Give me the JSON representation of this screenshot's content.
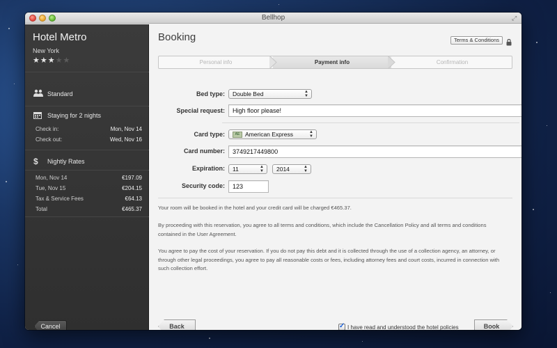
{
  "window": {
    "title": "Bellhop"
  },
  "sidebar": {
    "hotel_name": "Hotel Metro",
    "city": "New York",
    "stars_filled": 3,
    "stars_total": 5,
    "room_type": "Standard",
    "stay": {
      "heading": "Staying for 2 nights",
      "check_in_label": "Check in:",
      "check_in_value": "Mon, Nov 14",
      "check_out_label": "Check out:",
      "check_out_value": "Wed, Nov 16"
    },
    "rates": {
      "heading": "Nightly Rates",
      "items": [
        {
          "label": "Mon, Nov 14",
          "value": "€197.09"
        },
        {
          "label": "Tue, Nov 15",
          "value": "€204.15"
        },
        {
          "label": "Tax & Service Fees",
          "value": "€64.13"
        },
        {
          "label": "Total",
          "value": "€465.37"
        }
      ]
    },
    "cancel_label": "Cancel"
  },
  "main": {
    "title": "Booking",
    "terms_label": "Terms & Conditions",
    "steps": [
      {
        "label": "Personal info",
        "state": "done"
      },
      {
        "label": "Payment info",
        "state": "active"
      },
      {
        "label": "Confirmation",
        "state": "pending"
      }
    ],
    "form": {
      "bed_type_label": "Bed type:",
      "bed_type_value": "Double Bed",
      "special_request_label": "Special request:",
      "special_request_value": "High floor please!",
      "card_type_label": "Card type:",
      "card_type_value": "American Express",
      "card_number_label": "Card number:",
      "card_number_value": "3749217449800",
      "expiration_label": "Expiration:",
      "exp_month": "11",
      "exp_year": "2014",
      "security_code_label": "Security code:",
      "security_code_value": "123"
    },
    "notice": "Your room will be booked in the hotel and your credit card will be charged €465.37.",
    "agreement": "By proceeding with this reservation, you agree to all terms and conditions, which include the Cancellation Policy and all terms and conditions contained in the User Agreement.",
    "payment_terms": "You agree to pay the cost of your reservation. If you do not pay this debt and it is collected through the use of a collection agency, an attorney, or through other legal proceedings, you agree to pay all reasonable costs or fees, including attorney fees and court costs, incurred in connection with such collection effort.",
    "back_label": "Back",
    "policy_checkbox_label": "I have read and understood the hotel policies",
    "policy_checked": true,
    "book_label": "Book"
  }
}
